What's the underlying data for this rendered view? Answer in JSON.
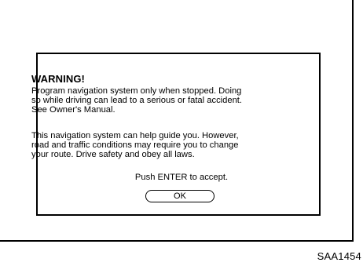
{
  "dialog": {
    "heading": "WARNING!",
    "paragraph1": [
      "Program navigation system only when stopped. Doing",
      "so while driving can lead to a serious or fatal accident.",
      "See Owner's Manual."
    ],
    "paragraph2": [
      "This navigation system can help guide you. However,",
      "road and traffic conditions may require you to change",
      "your route. Drive safety and obey all laws."
    ],
    "accept_prompt": "Push ENTER to accept.",
    "ok_label": "OK"
  },
  "figure_caption": "SAA1454"
}
